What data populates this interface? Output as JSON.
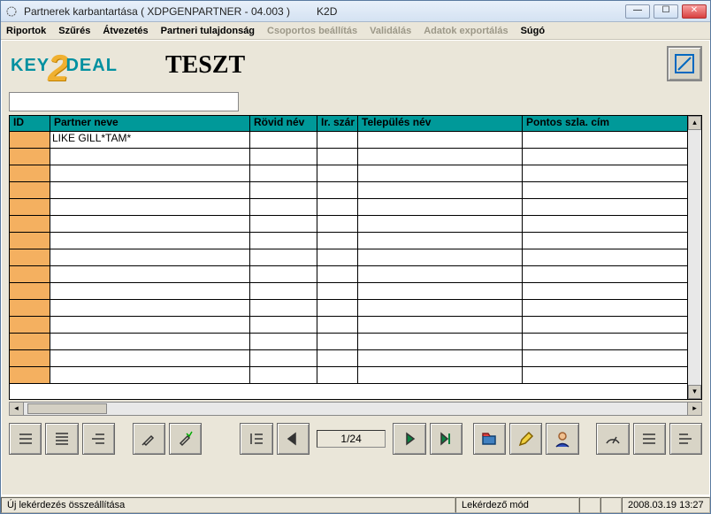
{
  "window": {
    "title": "Partnerek karbantartása ( XDPGENPARTNER - 04.003 )",
    "title_suffix": "K2D"
  },
  "menu": {
    "items": [
      {
        "label": "Riportok",
        "enabled": true
      },
      {
        "label": "Szűrés",
        "enabled": true
      },
      {
        "label": "Átvezetés",
        "enabled": true
      },
      {
        "label": "Partneri tulajdonság",
        "enabled": true
      },
      {
        "label": "Csoportos beállítás",
        "enabled": false
      },
      {
        "label": "Validálás",
        "enabled": false
      },
      {
        "label": "Adatok exportálás",
        "enabled": false
      },
      {
        "label": "Súgó",
        "enabled": true
      }
    ]
  },
  "header": {
    "logo_left": "KEY",
    "logo_right": "DEAL",
    "page_title": "TESZT"
  },
  "grid": {
    "columns": {
      "id": "ID",
      "name": "Partner neve",
      "rovid": "Rövid név",
      "ir": "Ir. szár",
      "tel": "Település név",
      "cim": "Pontos szla. cím"
    },
    "rows": [
      {
        "id": "",
        "name": "LIKE GILL*TAM*",
        "rovid": "",
        "ir": "",
        "tel": "",
        "cim": ""
      },
      {
        "id": "",
        "name": "",
        "rovid": "",
        "ir": "",
        "tel": "",
        "cim": ""
      },
      {
        "id": "",
        "name": "",
        "rovid": "",
        "ir": "",
        "tel": "",
        "cim": ""
      },
      {
        "id": "",
        "name": "",
        "rovid": "",
        "ir": "",
        "tel": "",
        "cim": ""
      },
      {
        "id": "",
        "name": "",
        "rovid": "",
        "ir": "",
        "tel": "",
        "cim": ""
      },
      {
        "id": "",
        "name": "",
        "rovid": "",
        "ir": "",
        "tel": "",
        "cim": ""
      },
      {
        "id": "",
        "name": "",
        "rovid": "",
        "ir": "",
        "tel": "",
        "cim": ""
      },
      {
        "id": "",
        "name": "",
        "rovid": "",
        "ir": "",
        "tel": "",
        "cim": ""
      },
      {
        "id": "",
        "name": "",
        "rovid": "",
        "ir": "",
        "tel": "",
        "cim": ""
      },
      {
        "id": "",
        "name": "",
        "rovid": "",
        "ir": "",
        "tel": "",
        "cim": ""
      },
      {
        "id": "",
        "name": "",
        "rovid": "",
        "ir": "",
        "tel": "",
        "cim": ""
      },
      {
        "id": "",
        "name": "",
        "rovid": "",
        "ir": "",
        "tel": "",
        "cim": ""
      },
      {
        "id": "",
        "name": "",
        "rovid": "",
        "ir": "",
        "tel": "",
        "cim": ""
      },
      {
        "id": "",
        "name": "",
        "rovid": "",
        "ir": "",
        "tel": "",
        "cim": ""
      },
      {
        "id": "",
        "name": "",
        "rovid": "",
        "ir": "",
        "tel": "",
        "cim": ""
      }
    ]
  },
  "toolbar": {
    "counter": "1/24"
  },
  "status": {
    "main": "Új lekérdezés összeállítása",
    "mode": "Lekérdező mód",
    "date": "2008.03.19 13:27"
  }
}
